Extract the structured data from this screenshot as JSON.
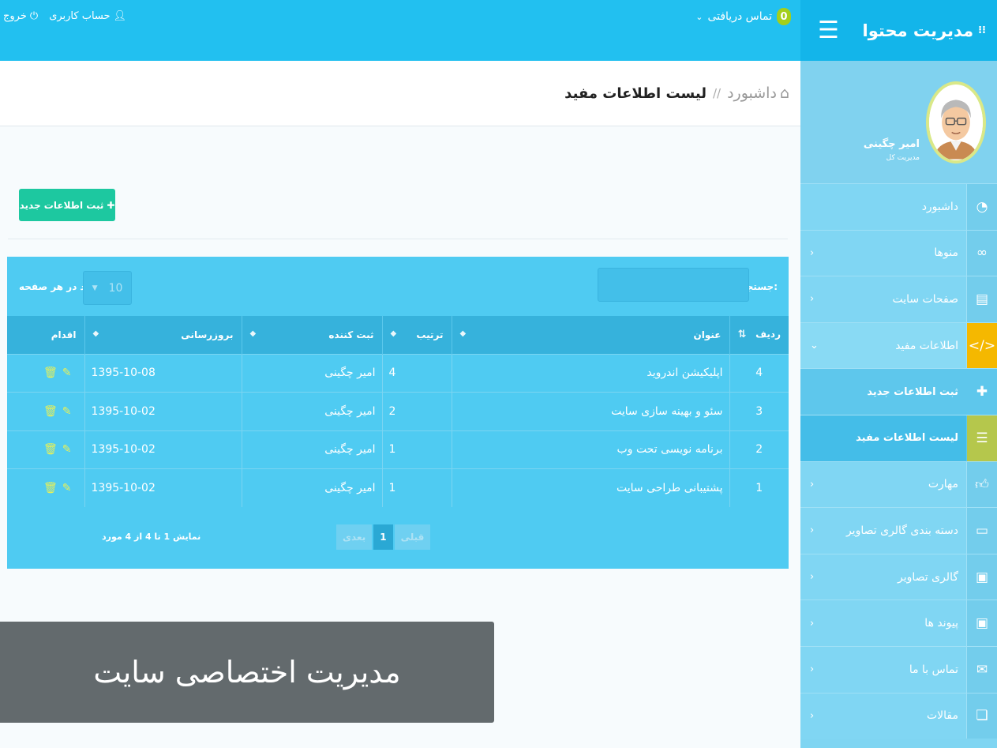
{
  "brand": {
    "title": "مدیریت محتوا",
    "grip_icon": "grip-icon",
    "menu_icon": "hamburger-icon"
  },
  "topbar": {
    "contact_count": "0",
    "contact_label": "تماس دریافتی",
    "account_label": "حساب کاربری",
    "logout_label": "خروج"
  },
  "profile": {
    "name": "امیر چگینی",
    "role": "مدیریت کل"
  },
  "menu": [
    {
      "label": "داشبورد",
      "icon": "dashboard-icon",
      "arrow": ""
    },
    {
      "label": "منوها",
      "icon": "link-icon",
      "arrow": "‹"
    },
    {
      "label": "صفحات سایت",
      "icon": "file-icon",
      "arrow": "‹"
    },
    {
      "label": "اطلاعات مفید",
      "icon": "code-icon",
      "arrow": "⌄"
    },
    {
      "label": "ثبت اطلاعات جدید",
      "icon": "plus-icon",
      "arrow": ""
    },
    {
      "label": "لیست اطلاعات مفید",
      "icon": "list-icon",
      "arrow": ""
    },
    {
      "label": "مهارت",
      "icon": "thumbs-up-icon",
      "arrow": "‹"
    },
    {
      "label": "دسته بندی گالری تصاویر",
      "icon": "folder-icon",
      "arrow": "‹"
    },
    {
      "label": "گالری تصاویر",
      "icon": "camera-icon",
      "arrow": "‹"
    },
    {
      "label": "پیوند ها",
      "icon": "camera-icon",
      "arrow": "‹"
    },
    {
      "label": "تماس با ما",
      "icon": "envelope-icon",
      "arrow": "‹"
    },
    {
      "label": "مقالات",
      "icon": "book-icon",
      "arrow": "‹"
    }
  ],
  "breadcrumb": {
    "home": "داشبورد",
    "separator": "//",
    "current": "لیست اطلاعات مفید"
  },
  "add_button": "ثبت اطلاعات جدید",
  "table_controls": {
    "search_label": "جستجو:",
    "length_value": "10",
    "length_label": "رکورد در هر صفحه"
  },
  "table": {
    "headers": [
      "ردیف",
      "عنوان",
      "ترتیب",
      "ثبت کننده",
      "بروزرسانی",
      "اقدام"
    ],
    "rows": [
      {
        "num": "4",
        "title": "اپلیکیشن اندروید",
        "order": "4",
        "author": "امیر چگینی",
        "updated": "1395-10-08"
      },
      {
        "num": "3",
        "title": "سئو و بهینه سازی سایت",
        "order": "2",
        "author": "امیر چگینی",
        "updated": "1395-10-02"
      },
      {
        "num": "2",
        "title": "برنامه نویسی تحت وب",
        "order": "1",
        "author": "امیر چگینی",
        "updated": "1395-10-02"
      },
      {
        "num": "1",
        "title": "پشتیبانی طراحی سایت",
        "order": "1",
        "author": "امیر چگینی",
        "updated": "1395-10-02"
      }
    ]
  },
  "pagination": {
    "prev": "قبلی",
    "current": "1",
    "next": "بعدی",
    "info": "نمایش 1 تا 4 از 4 مورد"
  },
  "caption": "مدیریت اختصاصی سایت",
  "colors": {
    "sidebar": "#7fd5f2",
    "topbar": "#22c0f0",
    "panel": "#4fcbf2",
    "accent_green": "#1dc8a0",
    "active_yellow": "#f5b800"
  }
}
